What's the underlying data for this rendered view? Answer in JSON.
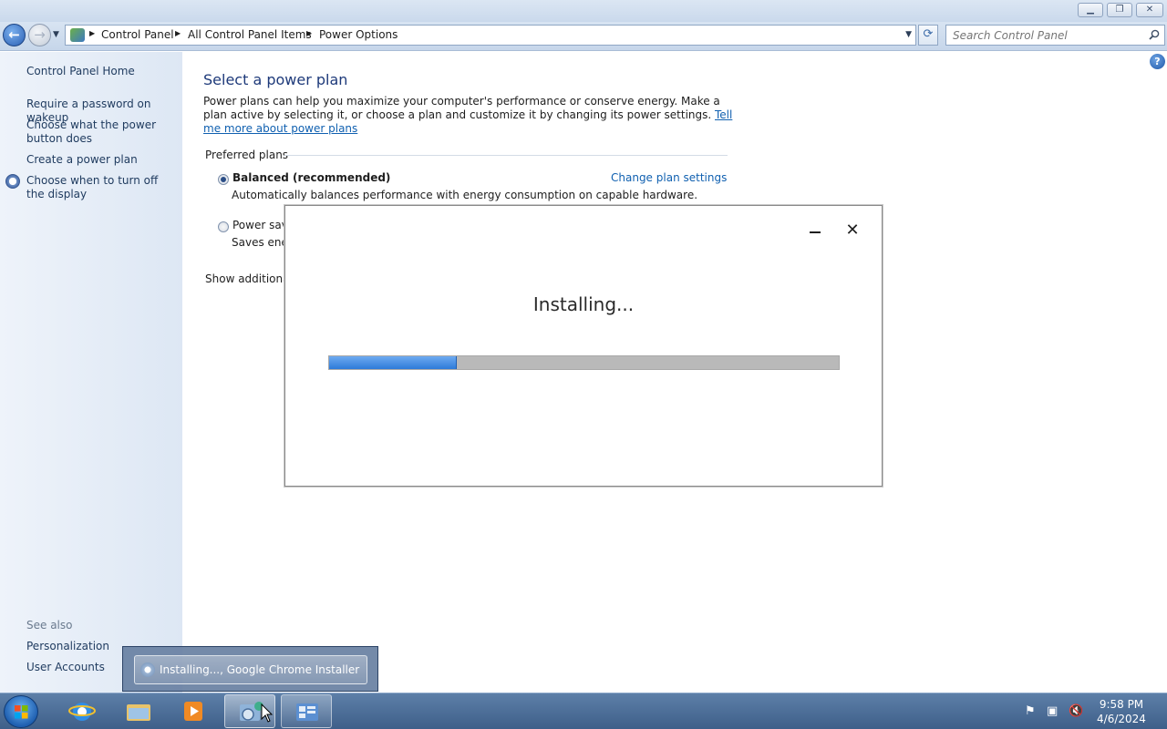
{
  "window": {
    "min_glyph": "▁",
    "max_glyph": "❐",
    "close_glyph": "✕"
  },
  "nav": {
    "back_glyph": "←",
    "forward_glyph": "→",
    "breadcrumbs": [
      "Control Panel",
      "All Control Panel Items",
      "Power Options"
    ],
    "refresh_glyph": "⟳",
    "search_placeholder": "Search Control Panel"
  },
  "sidebar": {
    "home": "Control Panel Home",
    "links": [
      "Require a password on wakeup",
      "Choose what the power button does",
      "Create a power plan",
      "Choose when to turn off the display"
    ],
    "see_also_label": "See also",
    "see_also": [
      "Personalization",
      "User Accounts"
    ]
  },
  "main": {
    "help_glyph": "?",
    "title": "Select a power plan",
    "intro_text": "Power plans can help you maximize your computer's performance or conserve energy. Make a plan active by selecting it, or choose a plan and customize it by changing its power settings. ",
    "intro_link": "Tell me more about power plans",
    "preferred_label": "Preferred plans",
    "plans": [
      {
        "name": "Balanced (recommended)",
        "description": "Automatically balances performance with energy consumption on capable hardware.",
        "selected": true,
        "settings_link": "Change plan settings"
      },
      {
        "name": "Power save",
        "description": "Saves energ",
        "selected": false
      }
    ],
    "show_more": "Show additional"
  },
  "installer": {
    "title": "Installing...",
    "progress_fraction": 0.25,
    "close_glyph": "✕"
  },
  "taskbar": {
    "popup_label": "Installing..., Google Chrome Installer",
    "clock_time": "9:58 PM",
    "clock_date": "4/6/2024"
  },
  "colors": {
    "accent": "#1060b0",
    "progress": "#2d7ad9",
    "taskbar": "#3e5f89"
  }
}
